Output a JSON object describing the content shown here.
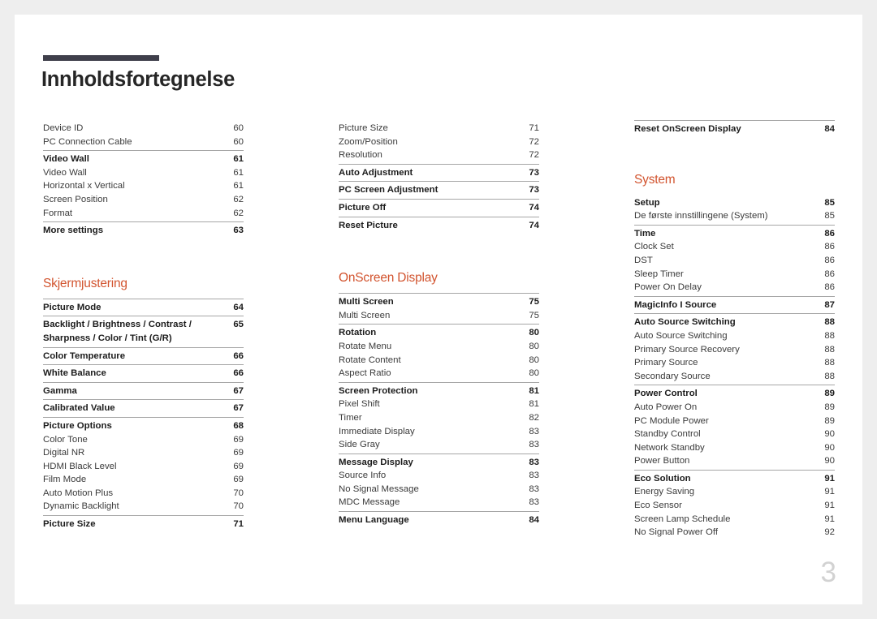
{
  "document": {
    "title": "Innholdsfortegnelse",
    "page_number": "3"
  },
  "colors": {
    "accent": "#d2542f",
    "title_bar": "#3f3f4b",
    "rule": "#a6a6a6",
    "page_number": "#d2d2d2"
  },
  "columns": [
    {
      "id": "column-1",
      "groups": [
        {
          "heading": null,
          "rule": false,
          "rows": [
            {
              "label": "Device ID",
              "page": "60",
              "bold": false
            },
            {
              "label": "PC Connection Cable",
              "page": "60",
              "bold": false
            }
          ]
        },
        {
          "heading": null,
          "rule": true,
          "rows": [
            {
              "label": "Video Wall",
              "page": "61",
              "bold": true
            },
            {
              "label": "Video Wall",
              "page": "61",
              "bold": false
            },
            {
              "label": "Horizontal x Vertical",
              "page": "61",
              "bold": false
            },
            {
              "label": "Screen Position",
              "page": "62",
              "bold": false
            },
            {
              "label": "Format",
              "page": "62",
              "bold": false
            }
          ]
        },
        {
          "heading": null,
          "rule": true,
          "rows": [
            {
              "label": "More settings",
              "page": "63",
              "bold": true
            }
          ]
        },
        {
          "heading": "Skjermjustering",
          "rule": true,
          "rows": [
            {
              "label": "Picture Mode",
              "page": "64",
              "bold": true
            }
          ]
        },
        {
          "heading": null,
          "rule": true,
          "multiline": true,
          "rows": [
            {
              "label": "Backlight / Brightness / Contrast / Sharpness / Color / Tint (G/R)",
              "page": "65",
              "bold": true
            }
          ]
        },
        {
          "heading": null,
          "rule": true,
          "rows": [
            {
              "label": "Color Temperature",
              "page": "66",
              "bold": true
            }
          ]
        },
        {
          "heading": null,
          "rule": true,
          "rows": [
            {
              "label": "White Balance",
              "page": "66",
              "bold": true
            }
          ]
        },
        {
          "heading": null,
          "rule": true,
          "rows": [
            {
              "label": "Gamma",
              "page": "67",
              "bold": true
            }
          ]
        },
        {
          "heading": null,
          "rule": true,
          "rows": [
            {
              "label": "Calibrated Value",
              "page": "67",
              "bold": true
            }
          ]
        },
        {
          "heading": null,
          "rule": true,
          "rows": [
            {
              "label": "Picture Options",
              "page": "68",
              "bold": true
            },
            {
              "label": "Color Tone",
              "page": "69",
              "bold": false
            },
            {
              "label": "Digital NR",
              "page": "69",
              "bold": false
            },
            {
              "label": "HDMI Black Level",
              "page": "69",
              "bold": false
            },
            {
              "label": "Film Mode",
              "page": "69",
              "bold": false
            },
            {
              "label": "Auto Motion Plus",
              "page": "70",
              "bold": false
            },
            {
              "label": "Dynamic Backlight",
              "page": "70",
              "bold": false
            }
          ]
        },
        {
          "heading": null,
          "rule": true,
          "rows": [
            {
              "label": "Picture Size",
              "page": "71",
              "bold": true
            }
          ]
        }
      ]
    },
    {
      "id": "column-2",
      "groups": [
        {
          "heading": null,
          "rule": false,
          "rows": [
            {
              "label": "Picture Size",
              "page": "71",
              "bold": false
            },
            {
              "label": "Zoom/Position",
              "page": "72",
              "bold": false
            },
            {
              "label": "Resolution",
              "page": "72",
              "bold": false
            }
          ]
        },
        {
          "heading": null,
          "rule": true,
          "rows": [
            {
              "label": "Auto Adjustment",
              "page": "73",
              "bold": true
            }
          ]
        },
        {
          "heading": null,
          "rule": true,
          "rows": [
            {
              "label": "PC Screen Adjustment",
              "page": "73",
              "bold": true
            }
          ]
        },
        {
          "heading": null,
          "rule": true,
          "rows": [
            {
              "label": "Picture Off",
              "page": "74",
              "bold": true
            }
          ]
        },
        {
          "heading": null,
          "rule": true,
          "rows": [
            {
              "label": "Reset Picture",
              "page": "74",
              "bold": true
            }
          ]
        },
        {
          "heading": "OnScreen Display",
          "rule": true,
          "rows": [
            {
              "label": "Multi Screen",
              "page": "75",
              "bold": true
            },
            {
              "label": "Multi Screen",
              "page": "75",
              "bold": false
            }
          ]
        },
        {
          "heading": null,
          "rule": true,
          "rows": [
            {
              "label": "Rotation",
              "page": "80",
              "bold": true
            },
            {
              "label": "Rotate Menu",
              "page": "80",
              "bold": false
            },
            {
              "label": "Rotate Content",
              "page": "80",
              "bold": false
            },
            {
              "label": "Aspect Ratio",
              "page": "80",
              "bold": false
            }
          ]
        },
        {
          "heading": null,
          "rule": true,
          "rows": [
            {
              "label": "Screen Protection",
              "page": "81",
              "bold": true
            },
            {
              "label": "Pixel Shift",
              "page": "81",
              "bold": false
            },
            {
              "label": "Timer",
              "page": "82",
              "bold": false
            },
            {
              "label": "Immediate Display",
              "page": "83",
              "bold": false
            },
            {
              "label": "Side Gray",
              "page": "83",
              "bold": false
            }
          ]
        },
        {
          "heading": null,
          "rule": true,
          "rows": [
            {
              "label": "Message Display",
              "page": "83",
              "bold": true
            },
            {
              "label": "Source Info",
              "page": "83",
              "bold": false
            },
            {
              "label": "No Signal Message",
              "page": "83",
              "bold": false
            },
            {
              "label": "MDC Message",
              "page": "83",
              "bold": false
            }
          ]
        },
        {
          "heading": null,
          "rule": true,
          "rows": [
            {
              "label": "Menu Language",
              "page": "84",
              "bold": true
            }
          ]
        }
      ]
    },
    {
      "id": "column-3",
      "groups": [
        {
          "heading": null,
          "rule": true,
          "rows": [
            {
              "label": "Reset OnScreen Display",
              "page": "84",
              "bold": true
            }
          ]
        },
        {
          "heading": "System",
          "rule": false,
          "rows": [
            {
              "label": "Setup",
              "page": "85",
              "bold": true
            },
            {
              "label": "De første innstillingene (System)",
              "page": "85",
              "bold": false
            }
          ]
        },
        {
          "heading": null,
          "rule": true,
          "rows": [
            {
              "label": "Time",
              "page": "86",
              "bold": true
            },
            {
              "label": "Clock Set",
              "page": "86",
              "bold": false
            },
            {
              "label": "DST",
              "page": "86",
              "bold": false
            },
            {
              "label": "Sleep Timer",
              "page": "86",
              "bold": false
            },
            {
              "label": "Power On Delay",
              "page": "86",
              "bold": false
            }
          ]
        },
        {
          "heading": null,
          "rule": true,
          "rows": [
            {
              "label": "MagicInfo I Source",
              "page": "87",
              "bold": true
            }
          ]
        },
        {
          "heading": null,
          "rule": true,
          "rows": [
            {
              "label": "Auto Source Switching",
              "page": "88",
              "bold": true
            },
            {
              "label": "Auto Source Switching",
              "page": "88",
              "bold": false
            },
            {
              "label": "Primary Source Recovery",
              "page": "88",
              "bold": false
            },
            {
              "label": "Primary Source",
              "page": "88",
              "bold": false
            },
            {
              "label": "Secondary Source",
              "page": "88",
              "bold": false
            }
          ]
        },
        {
          "heading": null,
          "rule": true,
          "rows": [
            {
              "label": "Power Control",
              "page": "89",
              "bold": true
            },
            {
              "label": "Auto Power On",
              "page": "89",
              "bold": false
            },
            {
              "label": "PC Module Power",
              "page": "89",
              "bold": false
            },
            {
              "label": "Standby Control",
              "page": "90",
              "bold": false
            },
            {
              "label": "Network Standby",
              "page": "90",
              "bold": false
            },
            {
              "label": "Power Button",
              "page": "90",
              "bold": false
            }
          ]
        },
        {
          "heading": null,
          "rule": true,
          "rows": [
            {
              "label": "Eco Solution",
              "page": "91",
              "bold": true
            },
            {
              "label": "Energy Saving",
              "page": "91",
              "bold": false
            },
            {
              "label": "Eco Sensor",
              "page": "91",
              "bold": false
            },
            {
              "label": "Screen Lamp Schedule",
              "page": "91",
              "bold": false
            },
            {
              "label": "No Signal Power Off",
              "page": "92",
              "bold": false
            }
          ]
        }
      ]
    }
  ]
}
